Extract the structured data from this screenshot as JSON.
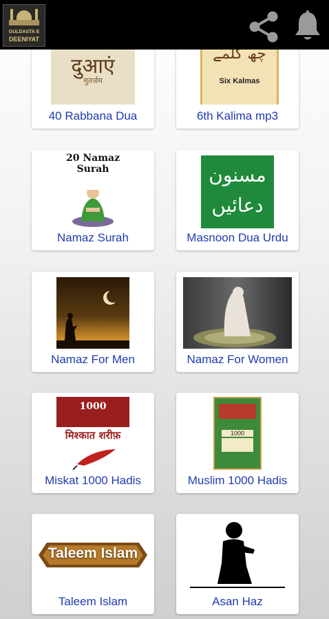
{
  "app": {
    "logo_line1": "GULDASTA E",
    "logo_line2": "DEENIYAT"
  },
  "toolbar": {
    "share_icon": "share-icon",
    "notifications_icon": "bell-icon"
  },
  "colors": {
    "appbar": "#000000",
    "label": "#1f3bb0",
    "card": "#ffffff"
  },
  "cards": [
    {
      "label": "40 Rabbana Dua",
      "image_text": "दुआएं",
      "image_subtext": "मुतर्जम"
    },
    {
      "label": "6th Kalima mp3",
      "image_text": "چھ کلمے",
      "image_subtext": "Six Kalmas"
    },
    {
      "label": "Namaz Surah",
      "image_text": "20 Namaz Surah"
    },
    {
      "label": "Masnoon Dua Urdu",
      "image_text": "مسنون",
      "image_subtext": "دعائیں"
    },
    {
      "label": "Namaz For Men"
    },
    {
      "label": "Namaz For Women"
    },
    {
      "label": "Miskat 1000 Hadis",
      "image_text": "1000",
      "image_subtext": "मिश्कात शरीफ़"
    },
    {
      "label": "Muslim 1000 Hadis",
      "image_text": "1000"
    },
    {
      "label": "Taleem Islam",
      "image_text": "Taleem Islam"
    },
    {
      "label": "Asan Haz"
    }
  ]
}
